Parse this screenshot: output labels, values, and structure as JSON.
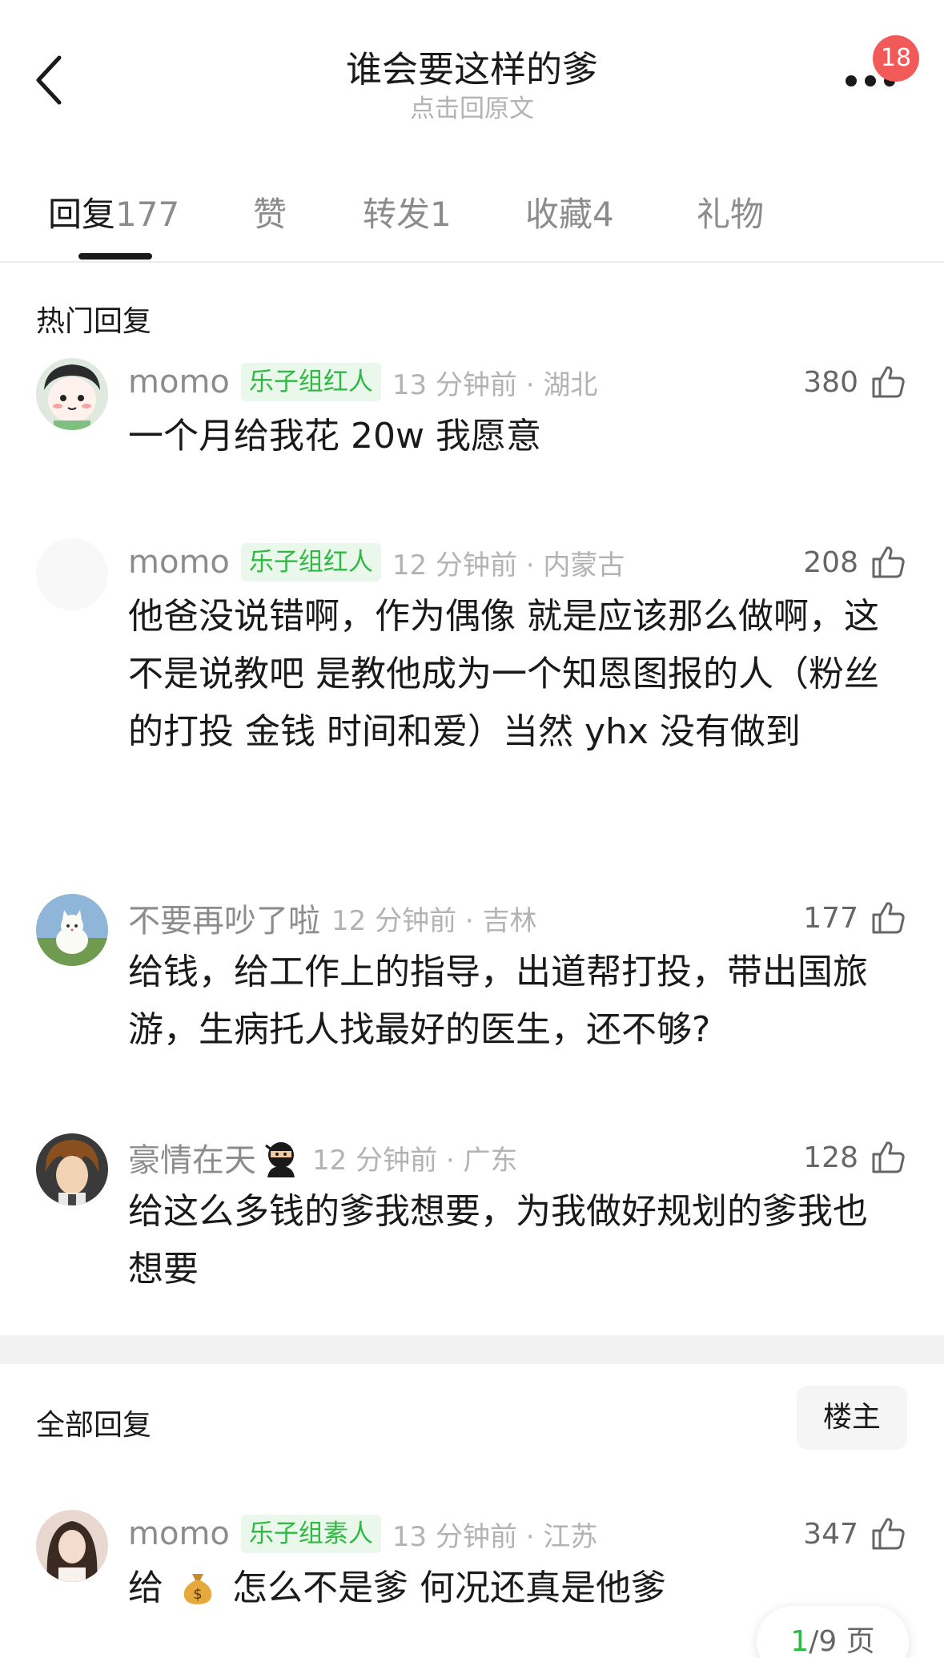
{
  "header": {
    "title": "谁会要这样的爹",
    "subtitle": "点击回原文",
    "badge_count": "18"
  },
  "tabs": [
    {
      "label": "回复",
      "count": "177",
      "active": true
    },
    {
      "label": "赞",
      "count": "",
      "active": false
    },
    {
      "label": "转发",
      "count": "1",
      "active": false
    },
    {
      "label": "收藏",
      "count": "4",
      "active": false
    },
    {
      "label": "礼物",
      "count": "",
      "active": false
    }
  ],
  "hot_section": {
    "title": "热门回复",
    "comments": [
      {
        "username": "momo",
        "tag": "乐子组红人",
        "time": "13 分钟前 · 湖北",
        "likes": "380",
        "content": "一个月给我花 20w 我愿意"
      },
      {
        "username": "momo",
        "tag": "乐子组红人",
        "time": "12 分钟前 · 内蒙古",
        "likes": "208",
        "content": "他爸没说错啊，作为偶像 就是应该那么做啊，这不是说教吧 是教他成为一个知恩图报的人（粉丝的打投 金钱 时间和爱）当然 yhx 没有做到"
      },
      {
        "username": "不要再吵了啦",
        "tag": "",
        "time": "12 分钟前 · 吉林",
        "likes": "177",
        "content": "给钱，给工作上的指导，出道帮打投，带出国旅游，生病托人找最好的医生，还不够?"
      },
      {
        "username": "豪情在天",
        "tag": "",
        "time": "12 分钟前 · 广东",
        "likes": "128",
        "content": "给这么多钱的爹我想要，为我做好规划的爹我也想要"
      }
    ]
  },
  "all_section": {
    "title": "全部回复",
    "owner_button": "楼主",
    "comments": [
      {
        "username": "momo",
        "tag": "乐子组素人",
        "time": "13 分钟前 · 江苏",
        "likes": "347",
        "content_before": "给",
        "content_after": "怎么不是爹  何况还真是他爹"
      }
    ]
  },
  "pagination": {
    "current": "1",
    "total_text": "/9 页"
  },
  "colors": {
    "accent_green": "#2fb844",
    "tag_bg": "#e9f8ea",
    "badge_red": "#f25a5a"
  }
}
